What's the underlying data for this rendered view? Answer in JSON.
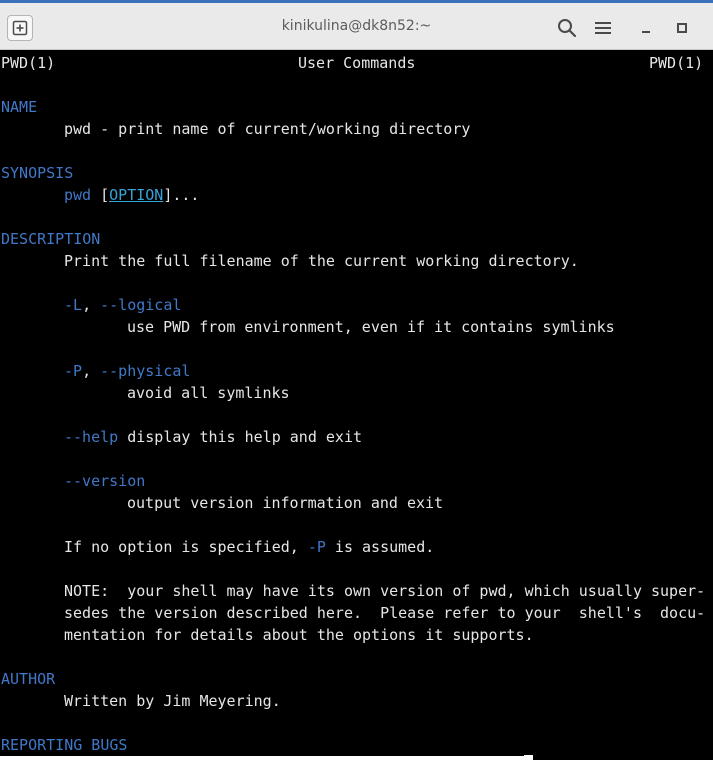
{
  "window": {
    "title": "kinikulina@dk8n52:~"
  },
  "man": {
    "header_left": "PWD(1)",
    "header_center": "User Commands",
    "header_right": "PWD(1)",
    "name_heading": "NAME",
    "name_text": "pwd - print name of current/working directory",
    "synopsis_heading": "SYNOPSIS",
    "synopsis_cmd": "pwd",
    "synopsis_open": "[",
    "synopsis_option": "OPTION",
    "synopsis_close": "]...",
    "description_heading": "DESCRIPTION",
    "description_text": "Print the full filename of the current working directory.",
    "opt_L_short": "-L",
    "opt_L_sep": ", ",
    "opt_L_long": "--logical",
    "opt_L_desc": "use PWD from environment, even if it contains symlinks",
    "opt_P_short": "-P",
    "opt_P_sep": ", ",
    "opt_P_long": "--physical",
    "opt_P_desc": "avoid all symlinks",
    "opt_help": "--help",
    "opt_help_desc": " display this help and exit",
    "opt_version": "--version",
    "opt_version_desc": "output version information and exit",
    "default_pre": "If no option is specified, ",
    "default_opt": "-P",
    "default_post": " is assumed.",
    "note_line1": "NOTE:  your shell may have its own version of pwd, which usually super-",
    "note_line2": "sedes the version described here.  Please refer to your  shell's  docu-",
    "note_line3": "mentation for details about the options it supports.",
    "author_heading": "AUTHOR",
    "author_text": "Written by Jim Meyering.",
    "bugs_heading": "REPORTING BUGS"
  },
  "icons": {
    "new_tab": "new-tab-icon",
    "search": "search-icon",
    "menu": "hamburger-menu-icon",
    "minimize": "minimize-icon",
    "maximize": "maximize-icon"
  },
  "colors": {
    "heading": "#4178c8",
    "text": "#e6e6e6",
    "background": "#000000",
    "titlebar": "#eaeaea"
  }
}
